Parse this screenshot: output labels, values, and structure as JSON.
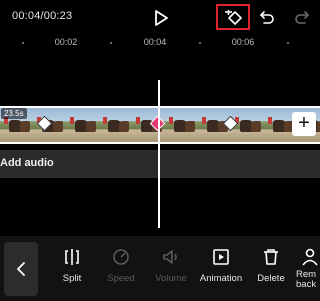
{
  "header": {
    "timecode": "00:04/00:23"
  },
  "ruler": {
    "ticks": [
      "00:02",
      "00:04",
      "00:06"
    ]
  },
  "track": {
    "duration": "23.5s"
  },
  "audio": {
    "label": "Add audio"
  },
  "toolbar": {
    "split": "Split",
    "speed": "Speed",
    "volume": "Volume",
    "animation": "Animation",
    "delete": "Delete",
    "remove_bg_line1": "Rem",
    "remove_bg_line2": "back"
  },
  "colors": {
    "keyframe_highlight": "#e0242e",
    "active_keyframe": "#e83a72"
  }
}
